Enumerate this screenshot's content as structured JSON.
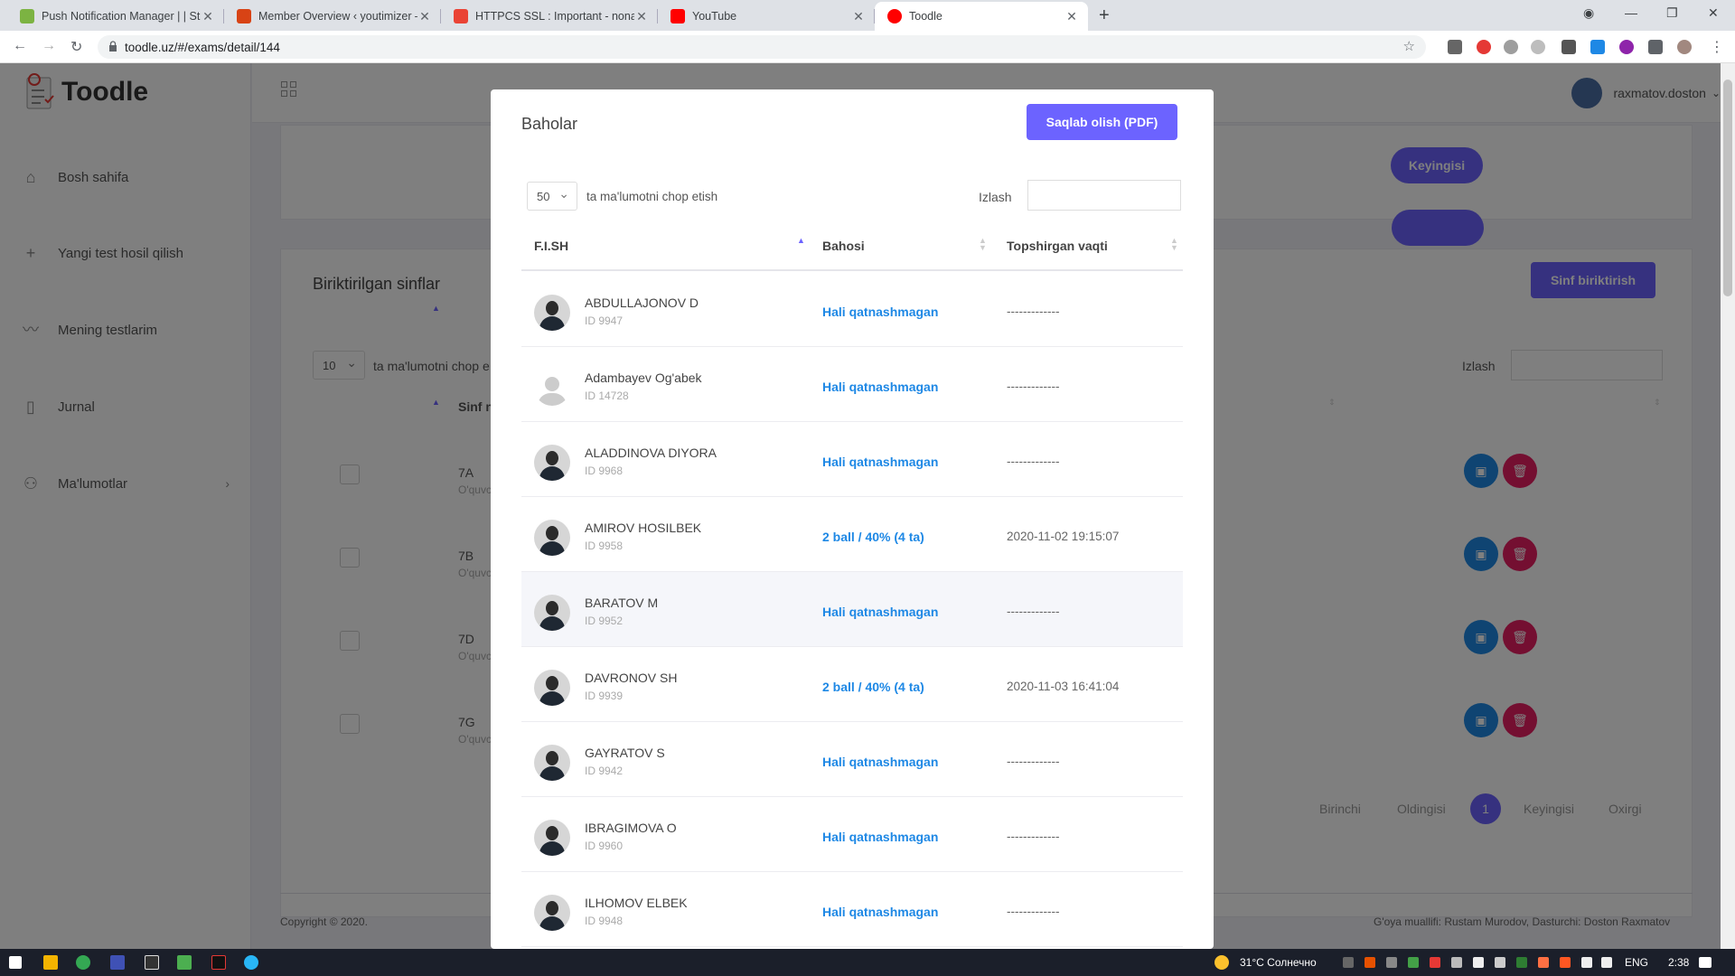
{
  "browser": {
    "tabs": [
      {
        "title": "Push Notification Manager | | Stu",
        "color": "#7cb342"
      },
      {
        "title": "Member Overview ‹ youtimizer –",
        "color": "#d84315"
      },
      {
        "title": "HTTPCS SSL : Important - nonam",
        "color": "#ea4335"
      },
      {
        "title": "YouTube",
        "color": "#ff0000"
      },
      {
        "title": "Toodle",
        "color": "#ff0000"
      }
    ],
    "url": "toodle.uz/#/exams/detail/144"
  },
  "app": {
    "brand": "Toodle",
    "sidebar": [
      {
        "label": "Bosh sahifa",
        "icon": "home-icon"
      },
      {
        "label": "Yangi test hosil qilish",
        "icon": "plus-icon"
      },
      {
        "label": "Mening testlarim",
        "icon": "chart-icon"
      },
      {
        "label": "Jurnal",
        "icon": "book-icon"
      },
      {
        "label": "Ma'lumotlar",
        "icon": "user-icon"
      }
    ],
    "user": "raxmatov.doston",
    "next_button": "Keyingisi",
    "classes_title": "Biriktirilgan sinflar",
    "assign_button": "Sinf biriktirish",
    "page_size": "10",
    "page_size_label": "ta ma'lumotni chop e",
    "search_label": "Izlash",
    "class_col": "Sinf n",
    "classes": [
      {
        "name": "7A",
        "sub": "O'quvc"
      },
      {
        "name": "7B",
        "sub": "O'quvc"
      },
      {
        "name": "7D",
        "sub": "O'quvc"
      },
      {
        "name": "7G",
        "sub": "O'quvc"
      }
    ],
    "pagination": {
      "first": "Birinchi",
      "prev": "Oldingisi",
      "current": "1",
      "next": "Keyingisi",
      "last": "Oxirgi"
    },
    "footer_left": "Copyright © 2020.",
    "footer_right": "G'oya muallifi: Rustam Murodov, Dasturchi: Doston Raxmatov"
  },
  "modal": {
    "title": "Baholar",
    "pdf_button": "Saqlab olish (PDF)",
    "page_size": "50",
    "page_size_label": "ta ma'lumotni chop etish",
    "search_label": "Izlash",
    "columns": [
      "F.I.SH",
      "Bahosi",
      "Topshirgan vaqti"
    ],
    "rows": [
      {
        "name": "ABDULLAJONOV D",
        "id": "ID 9947",
        "grade": "Hali qatnashmagan",
        "time": "-------------"
      },
      {
        "name": "Adambayev Og'abek",
        "id": "ID 14728",
        "grade": "Hali qatnashmagan",
        "time": "-------------"
      },
      {
        "name": "ALADDINOVA DIYORA",
        "id": "ID 9968",
        "grade": "Hali qatnashmagan",
        "time": "-------------"
      },
      {
        "name": "AMIROV HOSILBEK",
        "id": "ID 9958",
        "grade": "2 ball / 40% (4 ta)",
        "time": "2020-11-02 19:15:07"
      },
      {
        "name": "BARATOV M",
        "id": "ID 9952",
        "grade": "Hali qatnashmagan",
        "time": "-------------"
      },
      {
        "name": "DAVRONOV SH",
        "id": "ID 9939",
        "grade": "2 ball / 40% (4 ta)",
        "time": "2020-11-03 16:41:04"
      },
      {
        "name": "GAYRATOV S",
        "id": "ID 9942",
        "grade": "Hali qatnashmagan",
        "time": "-------------"
      },
      {
        "name": "IBRAGIMOVA O",
        "id": "ID 9960",
        "grade": "Hali qatnashmagan",
        "time": "-------------"
      },
      {
        "name": "ILHOMOV ELBEK",
        "id": "ID 9948",
        "grade": "Hali qatnashmagan",
        "time": "-------------"
      }
    ]
  },
  "taskbar": {
    "weather": "31°C  Солнечно",
    "lang": "ENG",
    "clock": "2:38"
  }
}
